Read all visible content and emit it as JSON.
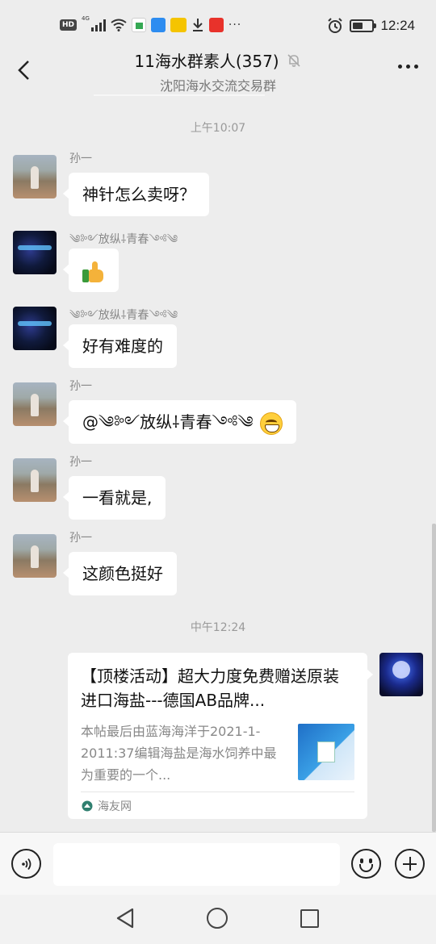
{
  "status_bar": {
    "badge": "HD",
    "network": "4G",
    "time": "12:24",
    "battery_level": 0.55,
    "overflow": "···",
    "icons": [
      "signal-icon",
      "wifi-icon",
      "home-app-icon",
      "message-app-icon",
      "news-app-icon",
      "download-icon",
      "shopping-app-icon",
      "alarm-icon",
      "battery-icon"
    ]
  },
  "header": {
    "title": "11海水群素人(357)",
    "subtitle": "沈阳海水交流交易群",
    "muted": true
  },
  "chat": {
    "timestamp_1": "上午10:07",
    "timestamp_2": "中午12:24",
    "messages": [
      {
        "sender": "孙一",
        "text": "神针怎么卖呀？"
      },
      {
        "sender": "༄༻放纵⸸青春༺༄",
        "text": ""
      },
      {
        "sender": "༄༻放纵⸸青春༺༄",
        "text": "好有难度的"
      },
      {
        "sender": "孙一",
        "text": "@༄༻放纵⸸青春༺༄"
      },
      {
        "sender": "孙一",
        "text": "一看就是,"
      },
      {
        "sender": "孙一",
        "text": "这颜色挺好"
      }
    ],
    "link_card": {
      "title": "【顶楼活动】超大力度免费赠送原装进口海盐---德国AB品牌...",
      "description": "本帖最后由蓝海海洋于2021-1-2011:37编辑海盐是海水饲养中最为重要的一个...",
      "source": "海友网"
    }
  },
  "input_bar": {
    "text_value": ""
  },
  "colors": {
    "background": "#ededed",
    "bubble": "#ffffff",
    "muted_text": "#888888"
  }
}
